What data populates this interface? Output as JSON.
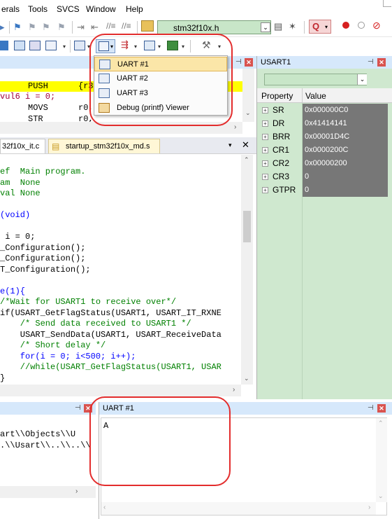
{
  "menubar": {
    "items": [
      "erals",
      "Tools",
      "SVCS",
      "Window",
      "Help"
    ]
  },
  "toolbar": {
    "target_select": "stm32f10x.h"
  },
  "dropdown": {
    "items": [
      {
        "label": "UART #1"
      },
      {
        "label": "UART #2"
      },
      {
        "label": "UART #3"
      },
      {
        "label": "Debug (printf) Viewer"
      }
    ]
  },
  "disasm": {
    "lines": [
      "PUSH      {r3",
      "vul6 i = 0;",
      "MOVS      r0,",
      "STR       r0,"
    ]
  },
  "editor": {
    "tabs": [
      {
        "label": "32f10x_it.c"
      },
      {
        "label": "startup_stm32f10x_md.s"
      }
    ],
    "code": [
      "ef  Main program.",
      "am  None",
      "val None",
      "",
      "(void)",
      "",
      " i = 0;",
      "_Configuration();",
      "_Configuration();",
      "T_Configuration();",
      "",
      "e(1){",
      "/*Wait for USART1 to receive over*/",
      "if(USART_GetFlagStatus(USART1, USART_IT_RXNE",
      "    /* Send data received to USART1 */",
      "    USART_SendData(USART1, USART_ReceiveData",
      "    /* Short delay */",
      "    for(i = 0; i<500; i++);",
      "    //while(USART_GetFlagStatus(USART1, USAR",
      "}"
    ]
  },
  "registers": {
    "title": "USART1",
    "col_property": "Property",
    "col_value": "Value",
    "rows": [
      {
        "name": "SR",
        "value": "0x000000C0"
      },
      {
        "name": "DR",
        "value": "0x41414141"
      },
      {
        "name": "BRR",
        "value": "0x00001D4C"
      },
      {
        "name": "CR1",
        "value": "0x0000200C"
      },
      {
        "name": "CR2",
        "value": "0x00000200"
      },
      {
        "name": "CR3",
        "value": "0"
      },
      {
        "name": "GTPR",
        "value": "0"
      }
    ]
  },
  "build_output": {
    "lines": [
      "art\\\\Objects\\\\U",
      ".\\\\Usart\\\\..\\\\..\\\\"
    ]
  },
  "uart_window": {
    "title": "UART #1",
    "content": "A"
  },
  "colors": {
    "highlight_red": "#e32d2d",
    "editor_line_highlight": "#ffff00",
    "register_bg": "#cfe8cf"
  }
}
